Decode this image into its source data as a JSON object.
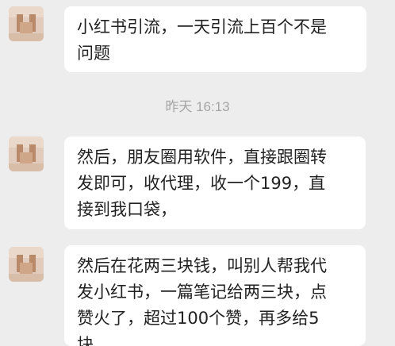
{
  "chat": {
    "messages": [
      {
        "lines": [
          "小红书引流，一天引流上百个不是",
          "问题"
        ]
      },
      {
        "lines": [
          "然后，朋友圈用软件，直接跟圈转",
          "发即可，收代理，收一个199，直",
          "接到我口袋，"
        ]
      },
      {
        "lines": [
          "然后在花两三块钱，叫别人帮我代",
          "发小红书，一篇笔记给两三块，点",
          "赞火了，超过100个赞，再多给5",
          "块"
        ]
      }
    ],
    "timestamp": "昨天 16:13"
  }
}
